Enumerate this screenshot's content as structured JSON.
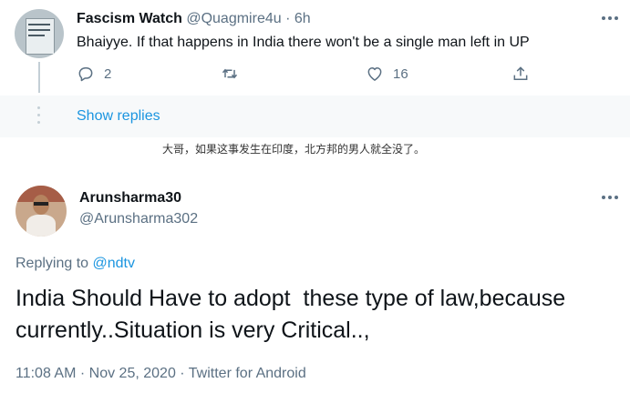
{
  "tweet1": {
    "display_name": "Fascism Watch",
    "handle": "@Quagmire4u",
    "separator": "·",
    "time": "6h",
    "text": "Bhaiyye. If that happens in India there won't be a single man left in UP",
    "reply_count": "2",
    "like_count": "16"
  },
  "show_replies": "Show replies",
  "translation": "大哥，如果这事发生在印度，北方邦的男人就全没了。",
  "tweet2": {
    "display_name": "Arunsharma30",
    "handle": "@Arunsharma302",
    "replying_prefix": "Replying to",
    "replying_to": "@ndtv",
    "text_line1": "India Should Have to adopt  these type of law,because",
    "text_line2": "currently..Situation is very Critical..,",
    "time": "11:08 AM",
    "date": "Nov 25, 2020",
    "source": "Twitter for Android",
    "meta_sep": "·"
  },
  "icons": [
    "reply-icon",
    "retweet-icon",
    "like-icon",
    "share-icon",
    "more-icon"
  ],
  "colors": {
    "link": "#1b95e0",
    "muted": "#5b7083",
    "text": "#0f1419"
  }
}
